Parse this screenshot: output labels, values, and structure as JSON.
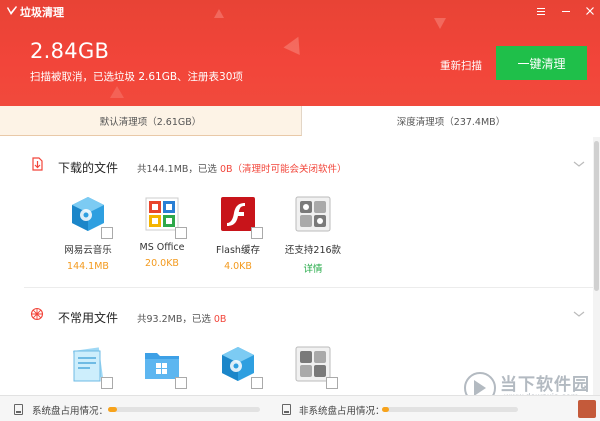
{
  "window": {
    "title": "垃圾清理",
    "controls": [
      "menu-icon",
      "minimize-icon",
      "close-icon"
    ]
  },
  "header": {
    "total_size": "2.84GB",
    "status_text": "扫描被取消，已选垃圾 2.61GB、注册表30项",
    "rescan_label": "重新扫描",
    "clean_button_label": "一键清理"
  },
  "tabs": [
    {
      "label": "默认清理项（2.61GB）",
      "active": true
    },
    {
      "label": "深度清理项（237.4MB）",
      "active": false
    }
  ],
  "sections": [
    {
      "title": "下载的文件",
      "summary_prefix": "共144.1MB，已选 ",
      "summary_selected": "0B",
      "summary_warning": "（清理时可能会关闭软件）",
      "icon": "download-icon",
      "items": [
        {
          "name": "网易云音乐",
          "size": "144.1MB",
          "icon": "cloud-music-icon"
        },
        {
          "name": "MS Office",
          "size": "20.0KB",
          "icon": "ms-office-icon"
        },
        {
          "name": "Flash缓存",
          "size": "4.0KB",
          "icon": "flash-icon"
        },
        {
          "name": "还支持216款",
          "size": "详情",
          "icon": "more-apps-icon",
          "link": true
        }
      ]
    },
    {
      "title": "不常用文件",
      "summary_prefix": "共93.2MB，已选 ",
      "summary_selected": "0B",
      "summary_warning": "",
      "icon": "gear-flower-icon",
      "items": [
        {
          "icon": "document-icon"
        },
        {
          "icon": "windows-folder-icon"
        },
        {
          "icon": "cube-icon"
        },
        {
          "icon": "apps-grid-icon"
        }
      ]
    }
  ],
  "footer": {
    "system_disk_label": "系统盘占用情况：",
    "system_disk_usage": 0.06,
    "other_disk_label": "非系统盘占用情况：",
    "other_disk_usage": 0.05
  },
  "watermark": {
    "text": "当下软件园",
    "url": "www.downxia.com"
  },
  "colors": {
    "header_red": "#f2453a",
    "clean_green": "#1fbf4a",
    "size_orange": "#f39a1e",
    "link_green": "#1fa843",
    "disk_fill": "#f7a31c"
  }
}
